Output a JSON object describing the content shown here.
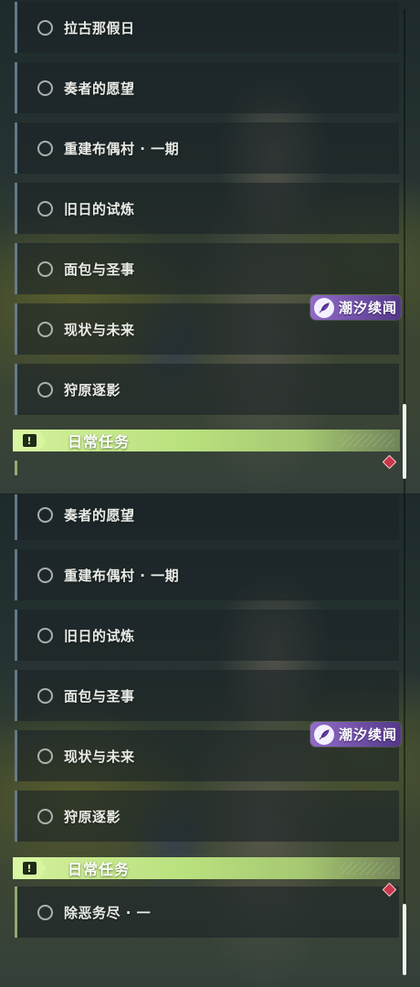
{
  "panel_top": {
    "quests": [
      "拉古那假日",
      "奏者的愿望",
      "重建布偶村 · 一期",
      "旧日的试炼",
      "面包与圣事",
      "现状与未来",
      "狩原逐影"
    ],
    "section_title": "日常任务",
    "section_icon": "!",
    "watermark": "潮汐续闻"
  },
  "panel_bottom": {
    "quests": [
      "奏者的愿望",
      "重建布偶村 · 一期",
      "旧日的试炼",
      "面包与圣事",
      "现状与未来",
      "狩原逐影"
    ],
    "section_title": "日常任务",
    "section_icon": "!",
    "daily_quests": [
      "除恶务尽 · 一"
    ],
    "watermark": "潮汐续闻"
  },
  "icons": {
    "quest_status": "circle-outline-icon",
    "section": "exclamation-alert-icon",
    "tracking_marker": "diamond-marker-icon",
    "watermark_logo": "feather-logo-icon"
  },
  "colors": {
    "section_accent": "#b9e07e",
    "marker": "#c9354a",
    "watermark": "#8a62c8"
  }
}
